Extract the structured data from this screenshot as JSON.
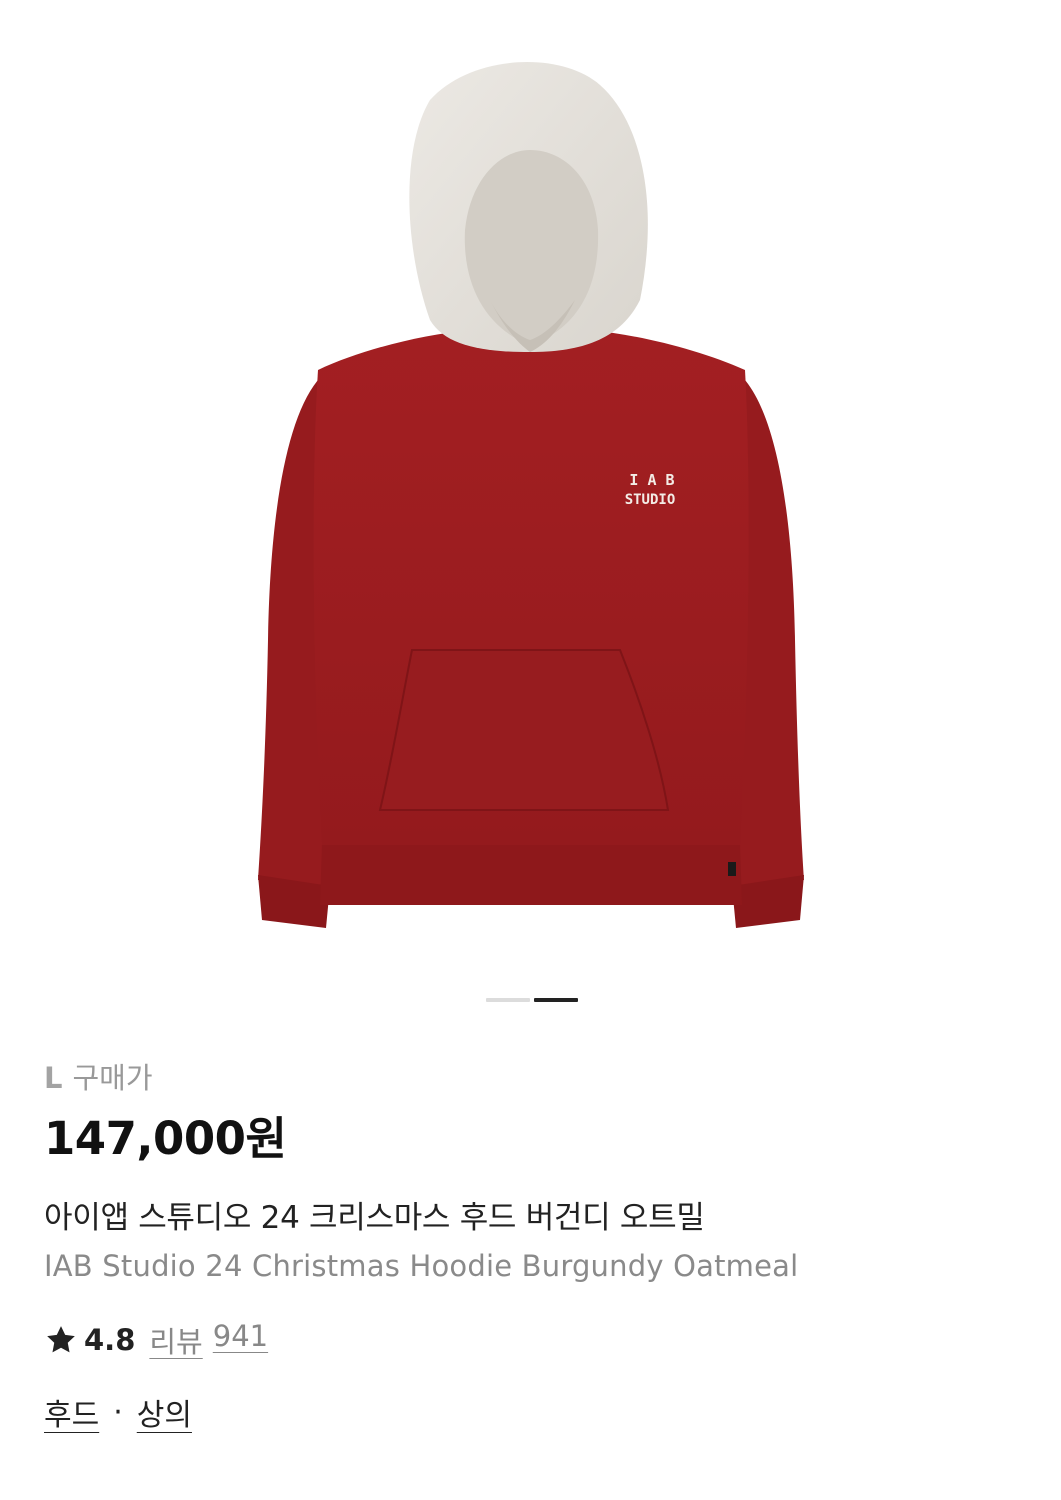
{
  "product": {
    "image_alt": "IAB Studio 24 Christmas Hoodie Burgundy Oatmeal",
    "logo_line1": "I A B",
    "logo_line2": "STUDIO",
    "carousel": {
      "count": 2,
      "active_index": 1
    },
    "size_label": "L",
    "price_type_label": "구매가",
    "price": "147,000원",
    "title_ko": "아이앱 스튜디오 24 크리스마스 후드 버건디 오트밀",
    "title_en": "IAB Studio 24 Christmas Hoodie Burgundy Oatmeal",
    "rating": "4.8",
    "review_label": "리뷰",
    "review_count": "941",
    "categories": [
      "후드",
      "상의"
    ],
    "category_separator": "·"
  },
  "icons": {
    "rating": "star-icon"
  },
  "colors": {
    "hoodie_body": "#9e1c1f",
    "hoodie_hood": "#e6e2dc",
    "indicator_active": "#222222",
    "indicator_inactive": "#dcdcdc"
  }
}
